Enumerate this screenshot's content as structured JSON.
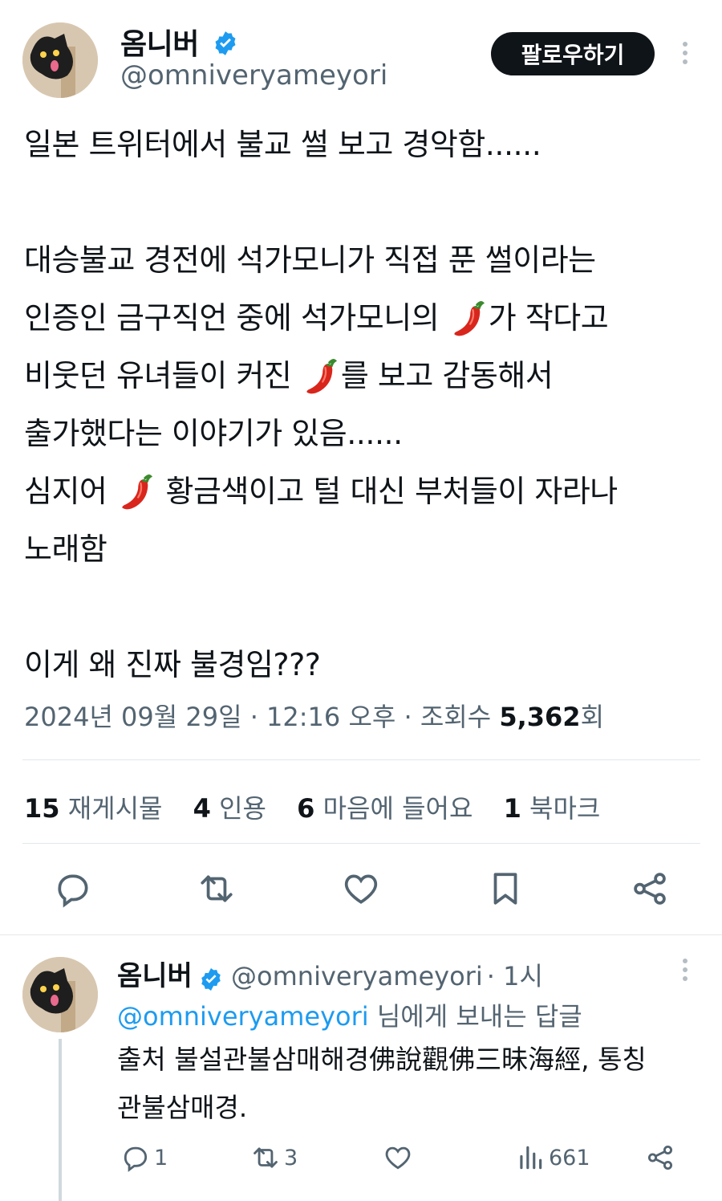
{
  "tweet": {
    "author_name": "옴니버",
    "author_handle": "@omniveryameyori",
    "follow_label": "팔로우하기",
    "lines": [
      {
        "segments": [
          {
            "t": "text",
            "v": "일본 트위터에서 불교 썰 보고 경악함......"
          }
        ]
      },
      {
        "segments": []
      },
      {
        "segments": [
          {
            "t": "text",
            "v": "대승불교 경전에 석가모니가 직접 푼 썰이라는"
          }
        ]
      },
      {
        "segments": [
          {
            "t": "text",
            "v": "인증인 금구직언 중에 석가모니의 "
          },
          {
            "t": "emoji",
            "v": "chili-pepper"
          },
          {
            "t": "text",
            "v": "가 작다고"
          }
        ]
      },
      {
        "segments": [
          {
            "t": "text",
            "v": "비웃던 유녀들이 커진 "
          },
          {
            "t": "emoji",
            "v": "chili-pepper"
          },
          {
            "t": "text",
            "v": "를 보고 감동해서"
          }
        ]
      },
      {
        "segments": [
          {
            "t": "text",
            "v": "출가했다는 이야기가 있음......"
          }
        ]
      },
      {
        "segments": [
          {
            "t": "text",
            "v": "심지어 "
          },
          {
            "t": "emoji",
            "v": "chili-pepper"
          },
          {
            "t": "text",
            "v": " 황금색이고 털 대신 부처들이 자라나"
          }
        ]
      },
      {
        "segments": [
          {
            "t": "text",
            "v": "노래함"
          }
        ]
      },
      {
        "segments": []
      },
      {
        "segments": [
          {
            "t": "text",
            "v": "이게 왜 진짜 불경임???"
          }
        ]
      }
    ],
    "meta_prefix": "2024년 09월 29일 · 12:16 오후 · 조회수 ",
    "views": "5,362",
    "views_suffix": "회",
    "stats": [
      {
        "num": "15",
        "label": "재게시물"
      },
      {
        "num": "4",
        "label": "인용"
      },
      {
        "num": "6",
        "label": "마음에 들어요"
      },
      {
        "num": "1",
        "label": "북마크"
      }
    ],
    "actions": [
      "reply-icon",
      "retweet-icon",
      "like-icon",
      "bookmark-icon",
      "share-icon"
    ]
  },
  "reply": {
    "author_name": "옴니버",
    "author_handle": "@omniveryameyori",
    "time": "· 1시",
    "reply_to_handle": "@omniveryameyori",
    "reply_to_suffix": " 님에게 보내는 답글",
    "text_lines": [
      "출처 불설관불삼매해경佛說觀佛三昧海經, 통칭",
      "관불삼매경."
    ],
    "counts": {
      "replies": "1",
      "retweets": "3",
      "views": "661"
    }
  },
  "colors": {
    "verified": "#1d9bf0",
    "text_primary": "#0f1419",
    "text_secondary": "#536471",
    "link": "#1d9bf0",
    "button_bg": "#0f1419"
  }
}
